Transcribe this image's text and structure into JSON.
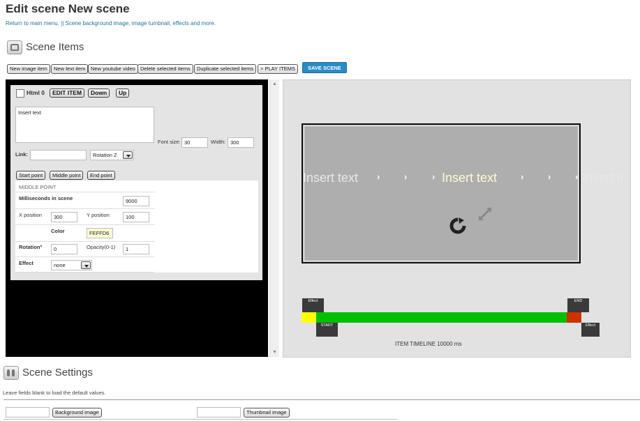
{
  "header": {
    "title": "Edit scene New scene",
    "link_main": "Return to main menu.",
    "link_sep": " || ",
    "link_desc": "Scene background image, image tumbnail, effects and more."
  },
  "scene_items": {
    "heading": "Scene Items",
    "buttons": {
      "new_image": "New image item",
      "new_text": "New text item",
      "new_youtube": "New youtube video",
      "delete": "Delete selected items",
      "duplicate": "Duplicate selected items",
      "play": "> PLAY ITEMS",
      "save": "SAVE SCENE"
    }
  },
  "editor": {
    "item_name": "Html 0",
    "edit_item": "EDIT ITEM",
    "down": "Down",
    "up": "Up",
    "text_value": "Insert text",
    "font_size_label": "Font size:",
    "font_size_value": "30",
    "width_label": "Width:",
    "width_value": "300",
    "link_label": "Link:",
    "link_value": "",
    "rotation_select": "Rotation Z",
    "start_point": "Start point",
    "middle_point": "Middle point",
    "end_point": "End point",
    "section_title": "MIDDLE POINT",
    "ms_label": "Milliseconds in scene",
    "ms_value": "9000",
    "x_label": "X position",
    "x_value": "300",
    "y_label": "Y position",
    "y_value": "100",
    "color_label": "Color",
    "color_value": "FEFFD6",
    "rotation_label": "Rotation°",
    "rotation_value": "0",
    "opacity_label": "Opacity(0-1)",
    "opacity_value": "1",
    "effect_label": "Effect",
    "effect_value": "none"
  },
  "preview": {
    "text_left": "Insert text",
    "text_center": "Insert text",
    "text_right": "Insert te",
    "chevron": "›",
    "timeline_effect_left": "Effect",
    "timeline_start": "START",
    "timeline_end": "END",
    "timeline_effect_right": "Effect",
    "timeline_label": "ITEM TIMELINE 10000 ms"
  },
  "scene_settings": {
    "heading": "Scene Settings",
    "note": "Leave fields blank to load the default values.",
    "background_button": "Background image",
    "thumbnail_button": "Thumbnail image"
  },
  "colors": {
    "accent": "#2b8bc4",
    "timeline_green": "#00c000",
    "timeline_start": "#ffff00",
    "timeline_end": "#cc3300",
    "item_color": "#FEFFD6"
  }
}
